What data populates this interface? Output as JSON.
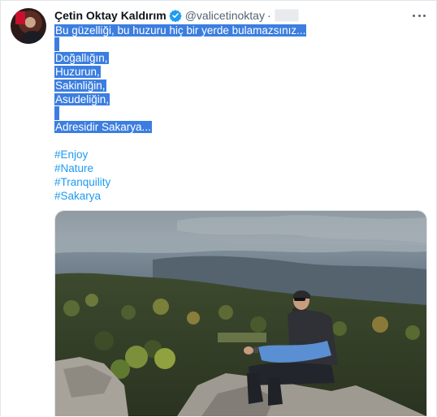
{
  "author": {
    "display_name": "Çetin Oktay Kaldırım",
    "handle": "@valicetinoktay",
    "separator": "·",
    "verified": true
  },
  "icons": {
    "verified": "verified-badge-icon",
    "more": "more-options-icon"
  },
  "colors": {
    "link": "#1d9bf0",
    "selection": "#3b7ee0",
    "verified": "#1d9bf0",
    "secondary_text": "#536471"
  },
  "tweet": {
    "lines": [
      "Bu güzelliği, bu huzuru hiç bir yerde bulamazsınız...",
      "",
      "Doğallığın,",
      "Huzurun,",
      "Sakinliğin,",
      "Asudeliğin,",
      "",
      "Adresidir Sakarya..."
    ],
    "hashtags": [
      "#Enjoy",
      "#Nature",
      "#Tranquility",
      "#Sakarya"
    ]
  }
}
